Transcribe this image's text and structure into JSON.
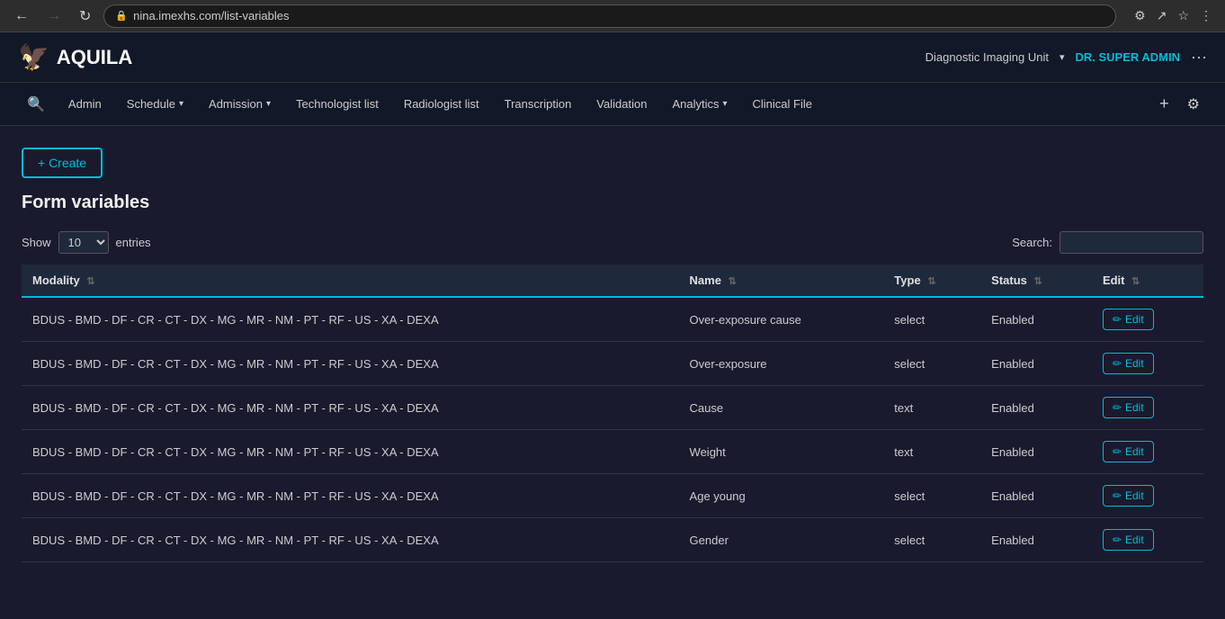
{
  "browser": {
    "url": "nina.imexhs.com/list-variables",
    "back_disabled": false,
    "forward_disabled": true
  },
  "header": {
    "logo_text": "AQUILA",
    "facility": "Diagnostic Imaging Unit",
    "user": "DR. SUPER ADMIN",
    "dots_label": "···"
  },
  "nav": {
    "search_placeholder": "Search",
    "items": [
      {
        "label": "Admin",
        "has_caret": false
      },
      {
        "label": "Schedule",
        "has_caret": true
      },
      {
        "label": "Admission",
        "has_caret": true
      },
      {
        "label": "Technologist list",
        "has_caret": false
      },
      {
        "label": "Radiologist list",
        "has_caret": false
      },
      {
        "label": "Transcription",
        "has_caret": false
      },
      {
        "label": "Validation",
        "has_caret": false
      },
      {
        "label": "Analytics",
        "has_caret": true
      },
      {
        "label": "Clinical File",
        "has_caret": false
      }
    ]
  },
  "page": {
    "create_btn": "+ Create",
    "title": "Form variables",
    "show_label": "Show",
    "entries_label": "entries",
    "entries_value": "10",
    "search_label": "Search:",
    "search_value": ""
  },
  "table": {
    "columns": [
      {
        "label": "Modality",
        "sortable": true
      },
      {
        "label": "Name",
        "sortable": true
      },
      {
        "label": "Type",
        "sortable": true
      },
      {
        "label": "Status",
        "sortable": true
      },
      {
        "label": "Edit",
        "sortable": true
      }
    ],
    "rows": [
      {
        "modality": "BDUS - BMD - DF - CR - CT - DX - MG - MR - NM - PT - RF - US - XA - DEXA",
        "name": "Over-exposure cause",
        "type": "select",
        "status": "Enabled"
      },
      {
        "modality": "BDUS - BMD - DF - CR - CT - DX - MG - MR - NM - PT - RF - US - XA - DEXA",
        "name": "Over-exposure",
        "type": "select",
        "status": "Enabled"
      },
      {
        "modality": "BDUS - BMD - DF - CR - CT - DX - MG - MR - NM - PT - RF - US - XA - DEXA",
        "name": "Cause",
        "type": "text",
        "status": "Enabled"
      },
      {
        "modality": "BDUS - BMD - DF - CR - CT - DX - MG - MR - NM - PT - RF - US - XA - DEXA",
        "name": "Weight",
        "type": "text",
        "status": "Enabled"
      },
      {
        "modality": "BDUS - BMD - DF - CR - CT - DX - MG - MR - NM - PT - RF - US - XA - DEXA",
        "name": "Age young",
        "type": "select",
        "status": "Enabled"
      },
      {
        "modality": "BDUS - BMD - DF - CR - CT - DX - MG - MR - NM - PT - RF - US - XA - DEXA",
        "name": "Gender",
        "type": "select",
        "status": "Enabled"
      }
    ],
    "edit_btn_label": "Edit"
  }
}
